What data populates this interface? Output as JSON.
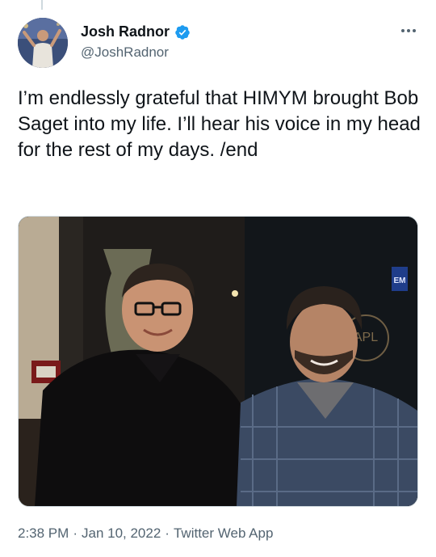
{
  "author": {
    "name": "Josh Radnor",
    "handle": "@JoshRadnor",
    "verified": true,
    "avatar_icon": "profile-photo"
  },
  "tweet": {
    "text": "I’m endlessly grateful that HIMYM brought Bob Saget into my life. I’ll hear his voice in my head for the rest of my days. /end",
    "photo_icon": "photo-two-men-portrait",
    "photo_signage": [
      "EM",
      "APL"
    ]
  },
  "meta": {
    "time": "2:38 PM",
    "separator1": "·",
    "date": "Jan 10, 2022",
    "separator2": "·",
    "source": "Twitter Web App"
  },
  "colors": {
    "verified_badge": "#1d9bf0",
    "secondary_text": "#536471",
    "primary_text": "#0f1419"
  }
}
